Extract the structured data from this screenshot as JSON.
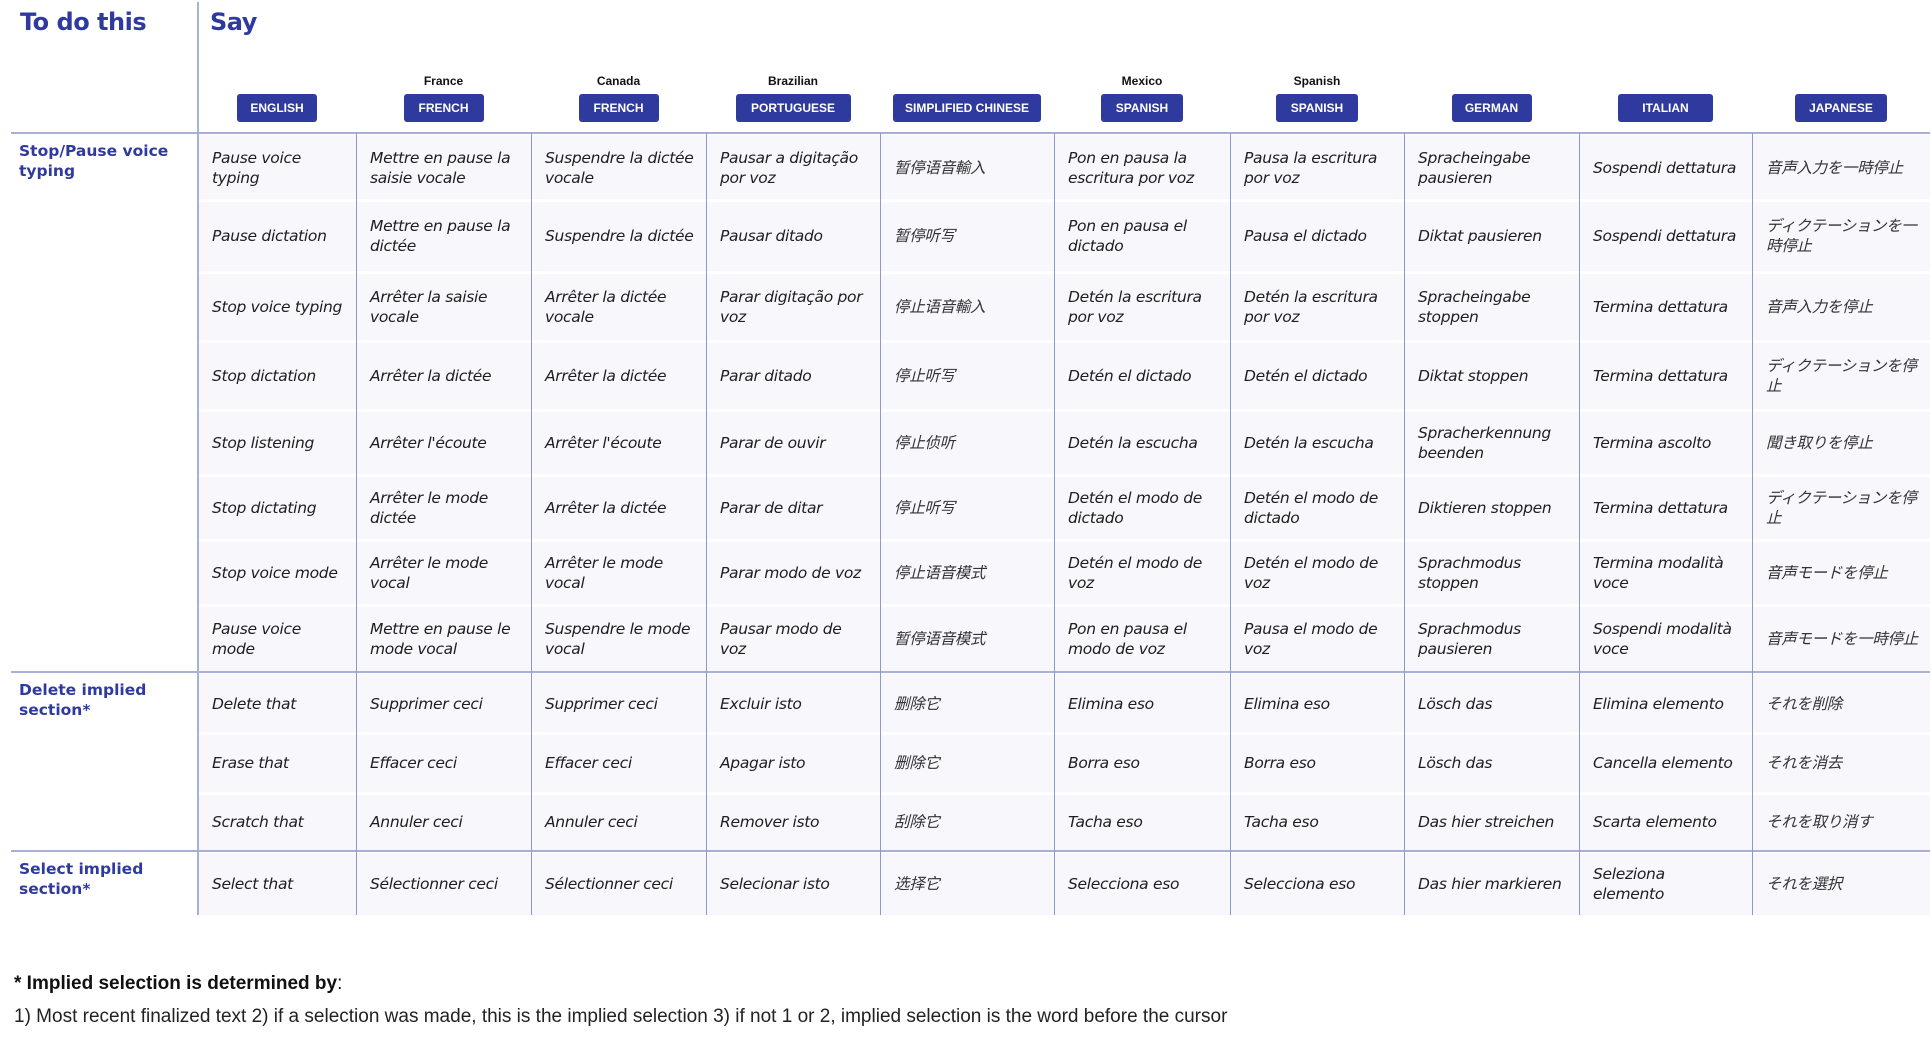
{
  "header": {
    "left_title": "To do this",
    "right_title": "Say"
  },
  "colors": {
    "accent": "#2e3a9e",
    "grid_line": "#a9b0d8",
    "cell_bg": "#f7f7fc"
  },
  "languages": [
    {
      "region": "",
      "label": "ENGLISH"
    },
    {
      "region": "France",
      "label": "FRENCH"
    },
    {
      "region": "Canada",
      "label": "FRENCH"
    },
    {
      "region": "Brazilian",
      "label": "PORTUGUESE"
    },
    {
      "region": "",
      "label": "SIMPLIFIED CHINESE"
    },
    {
      "region": "Mexico",
      "label": "SPANISH"
    },
    {
      "region": "Spanish",
      "label": "SPANISH"
    },
    {
      "region": "",
      "label": "GERMAN"
    },
    {
      "region": "",
      "label": "ITALIAN"
    },
    {
      "region": "",
      "label": "JAPANESE"
    }
  ],
  "sections": [
    {
      "label": "Stop/Pause voice typing",
      "rows": [
        [
          "Pause voice typing",
          "Mettre en pause la saisie vocale",
          "Suspendre la dictée vocale",
          "Pausar a digitação por voz",
          "暂停语音輸入",
          "Pon en pausa la escritura por voz",
          "Pausa la escritura por voz",
          "Spracheingabe pausieren",
          "Sospendi dettatura",
          "音声入力を一時停止"
        ],
        [
          "Pause dictation",
          "Mettre en pause la dictée",
          "Suspendre la dictée",
          "Pausar ditado",
          "暂停听写",
          "Pon en pausa el dictado",
          "Pausa el dictado",
          "Diktat pausieren",
          "Sospendi dettatura",
          "ディクテーションを一時停止"
        ],
        [
          "Stop voice typing",
          "Arrêter la saisie vocale",
          "Arrêter la dictée vocale",
          "Parar digitação por voz",
          "停止语音輸入",
          "Detén la escritura por voz",
          "Detén la escritura por voz",
          "Spracheingabe stoppen",
          "Termina dettatura",
          "音声入力を停止"
        ],
        [
          "Stop dictation",
          "Arrêter la dictée",
          "Arrêter la dictée",
          "Parar ditado",
          "停止听写",
          "Detén el dictado",
          "Detén el dictado",
          "Diktat stoppen",
          "Termina dettatura",
          "ディクテーションを停止"
        ],
        [
          "Stop listening",
          "Arrêter l'écoute",
          "Arrêter l'écoute",
          "Parar de ouvir",
          "停止侦听",
          "Detén la escucha",
          "Detén la escucha",
          "Spracherkennung beenden",
          "Termina ascolto",
          "聞き取りを停止"
        ],
        [
          "Stop dictating",
          "Arrêter le mode dictée",
          "Arrêter la dictée",
          "Parar de ditar",
          "停止听写",
          "Detén el modo de dictado",
          "Detén el modo de dictado",
          "Diktieren stoppen",
          "Termina dettatura",
          "ディクテーションを停止"
        ],
        [
          "Stop voice mode",
          "Arrêter le mode vocal",
          "Arrêter le mode vocal",
          "Parar modo de voz",
          "停止语音模式",
          "Detén el modo de voz",
          "Detén el modo de voz",
          "Sprachmodus stoppen",
          "Termina modalità voce",
          "音声モードを停止"
        ],
        [
          "Pause voice mode",
          "Mettre en pause le mode vocal",
          "Suspendre le mode vocal",
          "Pausar modo de voz",
          "暂停语音模式",
          "Pon en pausa el modo de voz",
          "Pausa el modo de voz",
          "Sprachmodus pausieren",
          "Sospendi modalità voce",
          "音声モードを一時停止"
        ]
      ]
    },
    {
      "label": "Delete implied section*",
      "rows": [
        [
          "Delete that",
          "Supprimer ceci",
          "Supprimer ceci",
          "Excluir isto",
          "删除它",
          "Elimina eso",
          "Elimina eso",
          "Lösch das",
          "Elimina elemento",
          "それを削除"
        ],
        [
          "Erase that",
          "Effacer ceci",
          "Effacer ceci",
          "Apagar isto",
          "删除它",
          "Borra eso",
          "Borra eso",
          "Lösch das",
          "Cancella elemento",
          "それを消去"
        ],
        [
          "Scratch that",
          "Annuler ceci",
          "Annuler ceci",
          "Remover isto",
          "刮除它",
          "Tacha eso",
          "Tacha eso",
          "Das hier streichen",
          "Scarta elemento",
          "それを取り消す"
        ]
      ]
    },
    {
      "label": "Select implied section*",
      "rows": [
        [
          "Select that",
          "Sélectionner ceci",
          "Sélectionner ceci",
          "Selecionar isto",
          "选择它",
          "Selecciona eso",
          "Selecciona eso",
          "Das hier markieren",
          "Seleziona elemento",
          "それを選択"
        ]
      ]
    }
  ],
  "footnote": {
    "title": "* Implied selection is determined by",
    "colon": ":",
    "text": "1) Most recent finalized text 2) if a selection was made, this is the implied selection 3) if not 1 or 2, implied selection is the word before the cursor"
  }
}
